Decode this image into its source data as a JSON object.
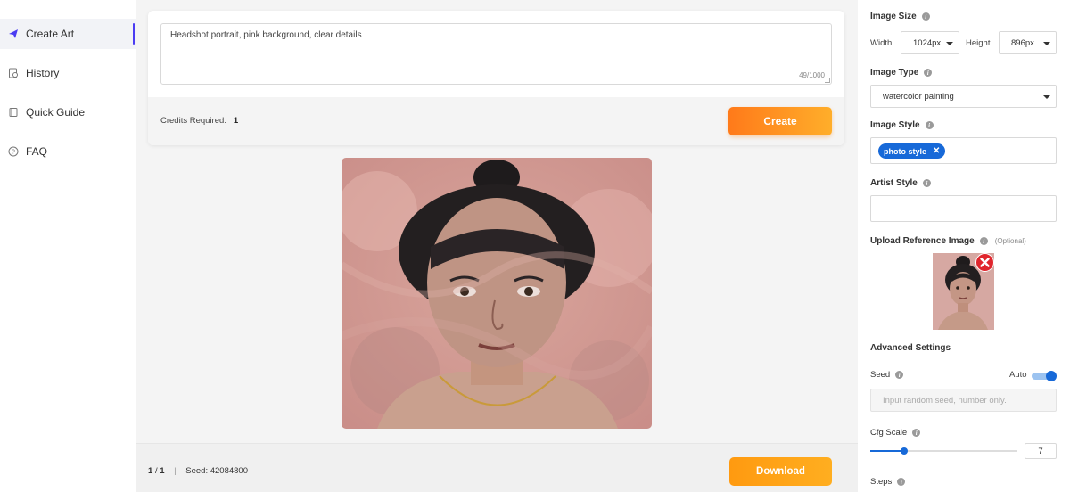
{
  "sidebar": {
    "items": [
      {
        "label": "Create Art",
        "icon": "paper-plane-icon",
        "active": true
      },
      {
        "label": "History",
        "icon": "history-icon",
        "active": false
      },
      {
        "label": "Quick Guide",
        "icon": "book-icon",
        "active": false
      },
      {
        "label": "FAQ",
        "icon": "question-icon",
        "active": false
      }
    ]
  },
  "prompt": {
    "text": "Headshot portrait, pink background, clear details",
    "count": "49/1000",
    "credits_label": "Credits Required:",
    "credits_value": "1",
    "create_label": "Create"
  },
  "result": {
    "page": "1",
    "sep": "/",
    "total": "1",
    "seed_label": "Seed:",
    "seed_value": "42084800",
    "download_label": "Download"
  },
  "panel": {
    "image_size": {
      "label": "Image Size",
      "width_label": "Width",
      "width_value": "1024px",
      "height_label": "Height",
      "height_value": "896px"
    },
    "image_type": {
      "label": "Image Type",
      "value": "watercolor painting"
    },
    "image_style": {
      "label": "Image Style",
      "chip": "photo style",
      "chip_remove": "✕"
    },
    "artist_style": {
      "label": "Artist Style"
    },
    "upload": {
      "label": "Upload Reference Image",
      "optional": "(Optional)"
    },
    "advanced": {
      "label": "Advanced Settings",
      "seed_label": "Seed",
      "auto_label": "Auto",
      "auto_on": true,
      "seed_placeholder": "Input random seed, number only.",
      "cfg_label": "Cfg Scale",
      "cfg_value": "7",
      "steps_label": "Steps"
    },
    "colors": {
      "accent": "#1769d8",
      "button": "#ff8a1e",
      "active_marker": "#4b3cf2"
    }
  }
}
